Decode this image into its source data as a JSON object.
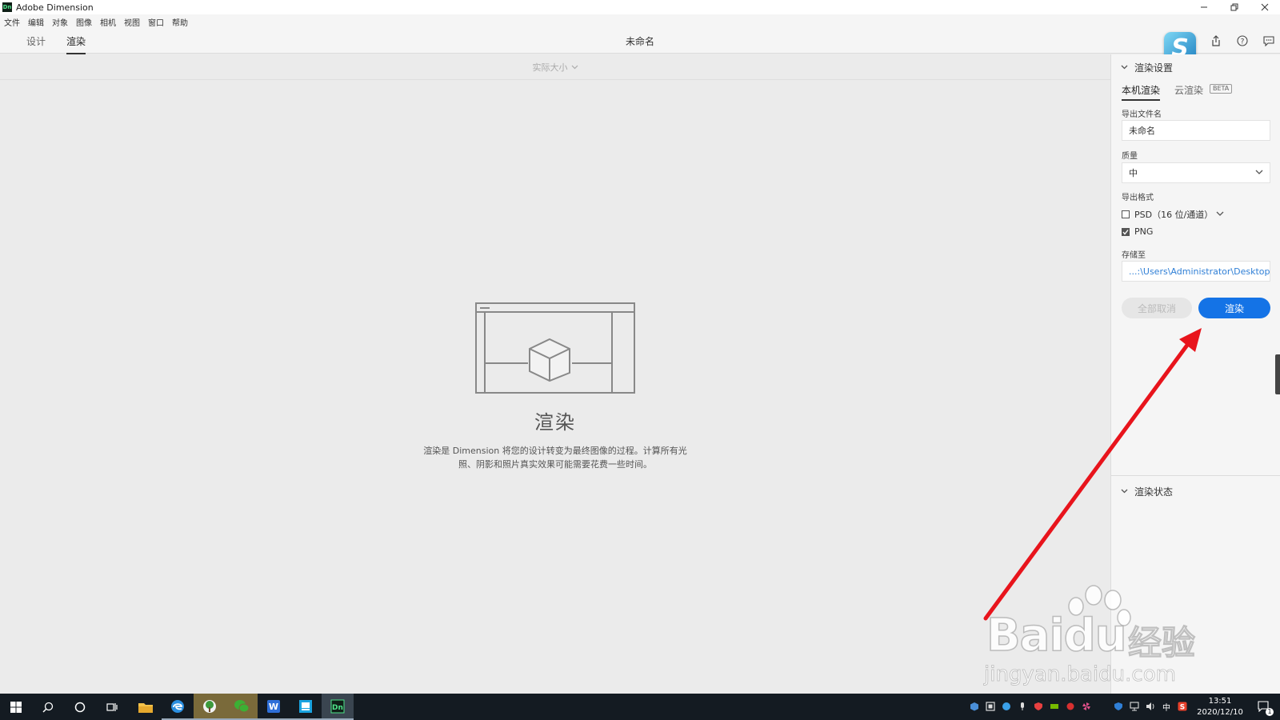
{
  "window": {
    "app_logo": "Dn",
    "title": "Adobe Dimension"
  },
  "menu": [
    "文件",
    "编辑",
    "对象",
    "图像",
    "相机",
    "视图",
    "窗口",
    "帮助"
  ],
  "header": {
    "tabs": [
      {
        "label": "设计"
      },
      {
        "label": "渲染"
      }
    ],
    "active_tab": "渲染",
    "doc_title": "未命名",
    "logo_letter": "S"
  },
  "canvas": {
    "zoom_label": "实际大小",
    "heading": "渲染",
    "description": "渲染是 Dimension 将您的设计转变为最终图像的过程。计算所有光照、阴影和照片真实效果可能需要花费一些时间。"
  },
  "panel": {
    "settings_title": "渲染设置",
    "tabs": {
      "local": "本机渲染",
      "cloud": "云渲染",
      "beta": "BETA"
    },
    "filename_label": "导出文件名",
    "filename_value": "未命名",
    "quality_label": "质量",
    "quality_value": "中",
    "format_label": "导出格式",
    "formats": [
      {
        "label": "PSD（16 位/通道）",
        "checked": false
      },
      {
        "label": "PNG",
        "checked": true
      }
    ],
    "save_label": "存储至",
    "save_path": "...:\\Users\\Administrator\\Desktop",
    "cancel_all": "全部取消",
    "render_button": "渲染",
    "status_title": "渲染状态"
  },
  "watermark": {
    "brand": "Bai",
    "brand2": "du",
    "cn": "经验",
    "url": "jingyan.baidu.com"
  },
  "taskbar": {
    "ime": "中",
    "time": "13:51",
    "date": "2020/12/10",
    "notification_count": "1"
  },
  "colors": {
    "accent": "#1473e6",
    "arrow": "#e8141c",
    "taskbar": "#141b22"
  }
}
